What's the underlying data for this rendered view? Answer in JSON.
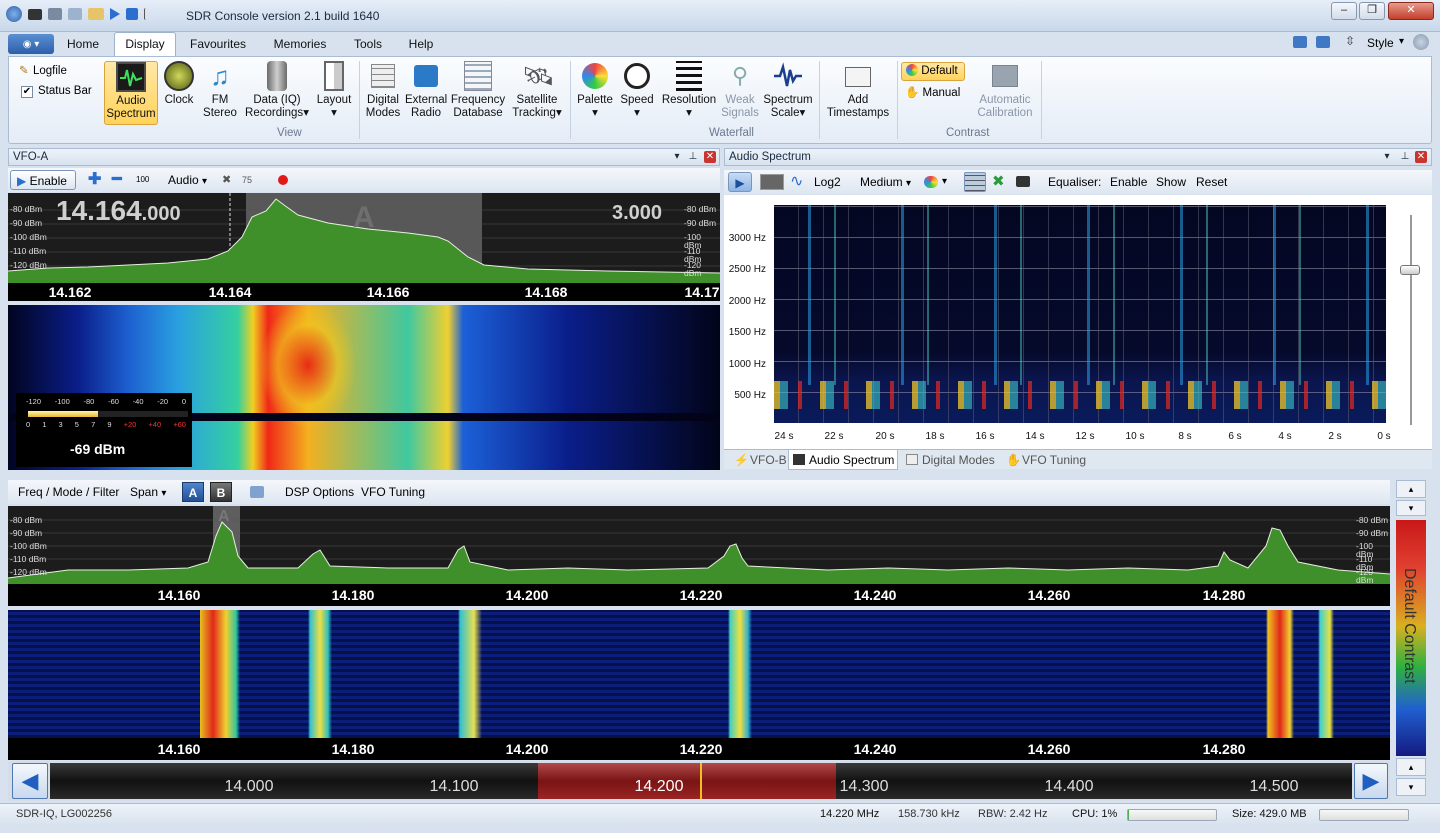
{
  "window": {
    "title": "SDR Console version 2.1 build 1640",
    "controls": [
      "–",
      "❐",
      "✕"
    ]
  },
  "ribbon_tabs": [
    "Home",
    "Display",
    "Favourites",
    "Memories",
    "Tools",
    "Help"
  ],
  "ribbon_tabs_active": "Display",
  "ribbon_right": {
    "style_label": "Style"
  },
  "ribbon": {
    "logfile": "Logfile",
    "status_bar": "Status Bar",
    "audio_spectrum": [
      "Audio",
      "Spectrum"
    ],
    "clock": [
      "Clock"
    ],
    "fm_stereo": [
      "FM",
      "Stereo"
    ],
    "data_iq": [
      "Data (IQ)",
      "Recordings"
    ],
    "layout": [
      "Layout"
    ],
    "digital_modes": [
      "Digital",
      "Modes"
    ],
    "external_radio": [
      "External",
      "Radio"
    ],
    "frequency_database": [
      "Frequency",
      "Database"
    ],
    "satellite_tracking": [
      "Satellite",
      "Tracking"
    ],
    "palette": [
      "Palette"
    ],
    "speed": [
      "Speed"
    ],
    "resolution": [
      "Resolution"
    ],
    "weak_signals": [
      "Weak",
      "Signals"
    ],
    "spectrum_scale": [
      "Spectrum",
      "Scale"
    ],
    "add_timestamps": [
      "Add",
      "Timestamps"
    ],
    "contrast_default": "Default",
    "contrast_manual": "Manual",
    "automatic_calibration": [
      "Automatic",
      "Calibration"
    ],
    "group_view": "View",
    "group_waterfall": "Waterfall",
    "group_contrast": "Contrast"
  },
  "vfo_a": {
    "header": "VFO-A",
    "enable": "Enable",
    "hundred": "100",
    "audio": "Audio",
    "freq_main": "14.164",
    "freq_sub": ".000",
    "bandwidth": "3.000",
    "marker": "A",
    "dbm_left": [
      "-80 dBm",
      "-90 dBm",
      "-100 dBm",
      "-110 dBm",
      "-120 dBm"
    ],
    "dbm_right": [
      "-80 dBm",
      "-90 dBm",
      "-100 dBm",
      "-110 dBm",
      "-120 dBm"
    ],
    "ticks": [
      "14.162",
      "14.164",
      "14.166",
      "14.168",
      "14.17"
    ],
    "smeter_top": [
      "-120",
      "-100",
      "-80",
      "-60",
      "-40",
      "-20",
      "0"
    ],
    "smeter_bottom": [
      "0",
      "1",
      "3",
      "5",
      "7",
      "9",
      "+20",
      "+40",
      "+60"
    ],
    "smeter_level": 0.44,
    "smeter_reading": "-69 dBm"
  },
  "audio_spectrum": {
    "header": "Audio Spectrum",
    "log2": "Log2",
    "medium": "Medium",
    "equaliser": "Equaliser:",
    "enable": "Enable",
    "show": "Show",
    "reset": "Reset",
    "hz_labels": [
      "3000 Hz",
      "2500 Hz",
      "2000 Hz",
      "1500 Hz",
      "1000 Hz",
      "500 Hz"
    ],
    "sec_labels": [
      "24 s",
      "22 s",
      "20 s",
      "18 s",
      "16 s",
      "14 s",
      "12 s",
      "10 s",
      "8 s",
      "6 s",
      "4 s",
      "2 s",
      "0 s"
    ]
  },
  "bottom_tabs": [
    "VFO-B",
    "Audio Spectrum",
    "Digital Modes",
    "VFO Tuning"
  ],
  "bottom_tabs_active": "Audio Spectrum",
  "main_spectrum": {
    "freq_mode_filter": "Freq / Mode / Filter",
    "span": "Span",
    "vfo_a_btn": "A",
    "vfo_b_btn": "B",
    "dsp_options": "DSP Options",
    "vfo_tuning": "VFO Tuning",
    "marker": "A",
    "dbm_left": [
      "-80 dBm",
      "-90 dBm",
      "-100 dBm",
      "-110 dBm",
      "-120 dBm"
    ],
    "dbm_right": [
      "-80 dBm",
      "-90 dBm",
      "-100 dBm",
      "-110 dBm",
      "-120 dBm"
    ],
    "ticks": [
      "14.160",
      "14.180",
      "14.200",
      "14.220",
      "14.240",
      "14.260",
      "14.280"
    ],
    "waterfall_ticks": [
      "14.160",
      "14.180",
      "14.200",
      "14.220",
      "14.240",
      "14.260",
      "14.280"
    ],
    "contrast_label": "Default Contrast"
  },
  "band_scale": {
    "ticks": [
      "14.000",
      "14.100",
      "14.200",
      "14.300",
      "14.400",
      "14.500"
    ]
  },
  "status": {
    "device": "SDR-IQ, LG002256",
    "freq": "14.220 MHz",
    "sample": "158.730 kHz",
    "rbw": "RBW: 2.42 Hz",
    "cpu": "CPU: 1%",
    "size": "Size: 429.0 MB"
  },
  "colors": {
    "accent": "#2b6cc4",
    "spectrum_fill": "#3f8f2a",
    "trace": "#e8f0e0",
    "band_highlight": "#8a1c1c"
  }
}
